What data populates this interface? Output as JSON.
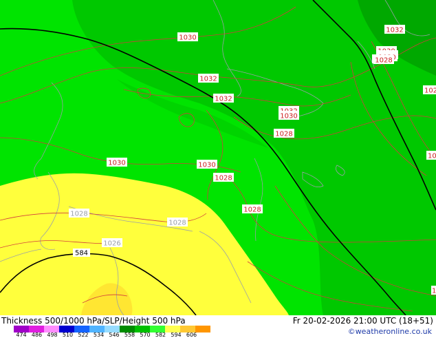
{
  "footer": {
    "title_left": "Thickness 500/1000 hPa/SLP/Height 500 hPa",
    "title_right": "Fr 20-02-2026 21:00 UTC (18+51)",
    "credit": "©weatheronline.co.uk"
  },
  "colorbar": {
    "ticks": [
      "474",
      "486",
      "498",
      "510",
      "522",
      "534",
      "546",
      "558",
      "570",
      "582",
      "594",
      "606"
    ],
    "colors": [
      "#a000c8",
      "#e01ee0",
      "#ff8cff",
      "#0000d0",
      "#1464ff",
      "#50b4ff",
      "#96dcff",
      "#008c00",
      "#00c000",
      "#32ff32",
      "#ffff50",
      "#ffc832",
      "#ff9600"
    ]
  },
  "map": {
    "isobar_labels": [
      "1030",
      "1032",
      "1032",
      "1032",
      "1030",
      "1028",
      "1030",
      "1030",
      "1028",
      "1028",
      "1028",
      "1028",
      "1026",
      "1032",
      "1030",
      "1028",
      "1032",
      "1030",
      "1028",
      "102",
      "10",
      "1"
    ],
    "height_label": "584"
  }
}
